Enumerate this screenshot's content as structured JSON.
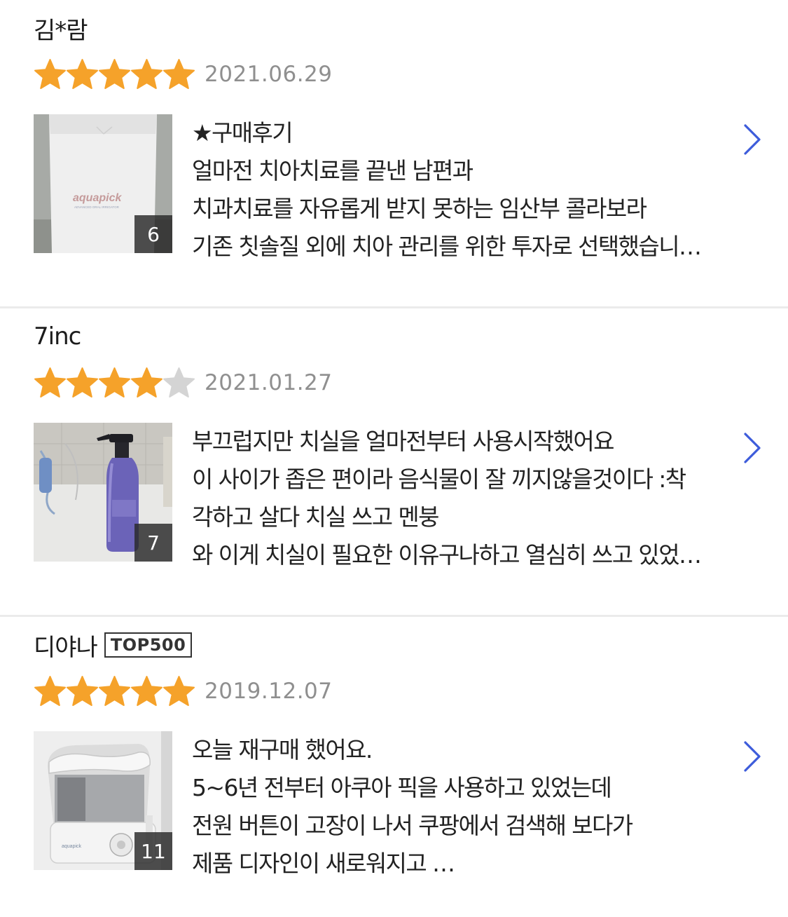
{
  "reviews": [
    {
      "reviewer": "김*람",
      "badge": "",
      "rating": 5,
      "date": "2021.06.29",
      "photo_count": "6",
      "lines": [
        "★구매후기",
        "얼마전 치아치료를 끝낸 남편과",
        "치과치료를 자유롭게 받지 못하는 임산부 콜라보라",
        "기존 칫솔질 외에 치아 관리를 위한 투자로 선택했습니…"
      ]
    },
    {
      "reviewer": "7inc",
      "badge": "",
      "rating": 4,
      "date": "2021.01.27",
      "photo_count": "7",
      "lines": [
        "부끄럽지만 치실을 얼마전부터 사용시작했어요",
        "이 사이가 좁은 편이라 음식물이 잘 끼지않을것이다 :착",
        "각하고 살다 치실 쓰고 멘붕",
        "와 이게 치실이 필요한 이유구나하고 열심히 쓰고 있었…"
      ]
    },
    {
      "reviewer": "디야나",
      "badge": "TOP500",
      "rating": 5,
      "date": "2019.12.07",
      "photo_count": "11",
      "lines": [
        "오늘 재구매 했어요.",
        "5~6년 전부터 아쿠아 픽을 사용하고 있었는데",
        "전원 버튼이 고장이 나서 쿠팡에서 검색해 보다가",
        "제품 디자인이 새로워지고 …"
      ]
    }
  ],
  "thumbnail_texts": {
    "box_brand": "aquapick",
    "box_subtitle": "ADVANCED ORAL IRRIGATOR"
  },
  "colors": {
    "star_filled": "#f5a22a",
    "star_empty": "#d4d4d4",
    "chevron": "#3d5cdb",
    "date": "#8f8f8f",
    "divider": "#ebebeb"
  },
  "icons": {
    "star": "star-icon",
    "chevron": "chevron-right-icon"
  }
}
